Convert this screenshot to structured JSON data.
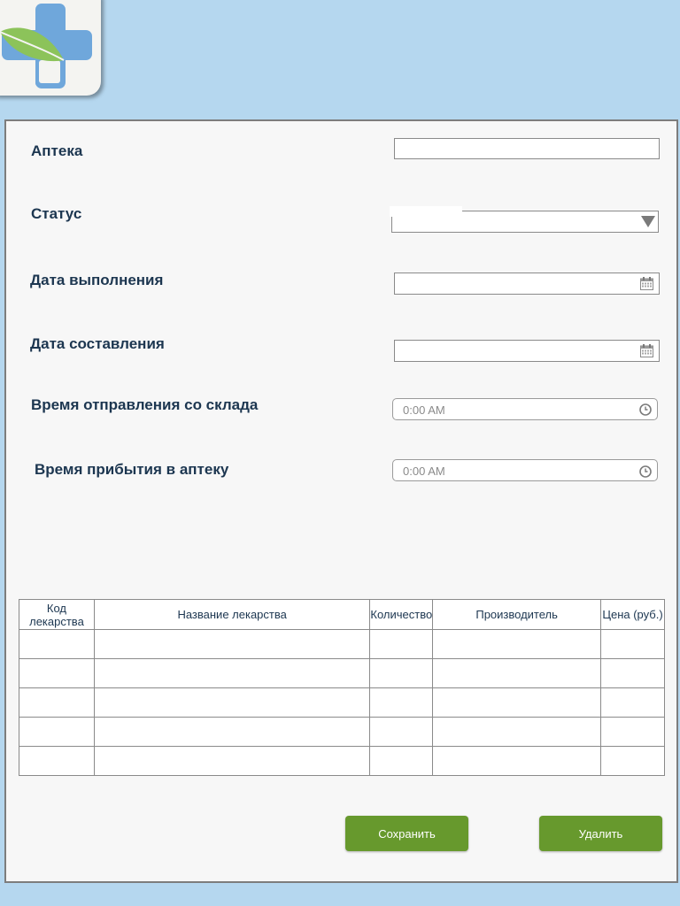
{
  "form": {
    "pharmacy_label": "Аптека",
    "pharmacy_value": "",
    "status_label": "Статус",
    "status_value": "",
    "completion_date_label": "Дата выполнения",
    "completion_date_value": "",
    "creation_date_label": "Дата составления",
    "creation_date_value": "",
    "departure_time_label": "Время отправления со склада",
    "departure_time_placeholder": "0:00 AM",
    "arrival_time_label": "Время прибытия в аптеку",
    "arrival_time_placeholder": "0:00 AM"
  },
  "table": {
    "columns": [
      "Код лекарства",
      "Название лекарства",
      "Количество",
      "Производитель",
      "Цена (руб.)"
    ],
    "rows": [
      [
        "",
        "",
        "",
        "",
        ""
      ],
      [
        "",
        "",
        "",
        "",
        ""
      ],
      [
        "",
        "",
        "",
        "",
        ""
      ],
      [
        "",
        "",
        "",
        "",
        ""
      ],
      [
        "",
        "",
        "",
        "",
        ""
      ]
    ]
  },
  "buttons": {
    "save": "Сохранить",
    "delete": "Удалить"
  },
  "icons": {
    "logo": "pharmacy-cross-leaf-icon",
    "date": "calendar-icon",
    "time": "clock-icon",
    "dropdown": "caret-down-icon"
  },
  "colors": {
    "background": "#b5d7ef",
    "button": "#67992d",
    "label": "#1c3650"
  }
}
